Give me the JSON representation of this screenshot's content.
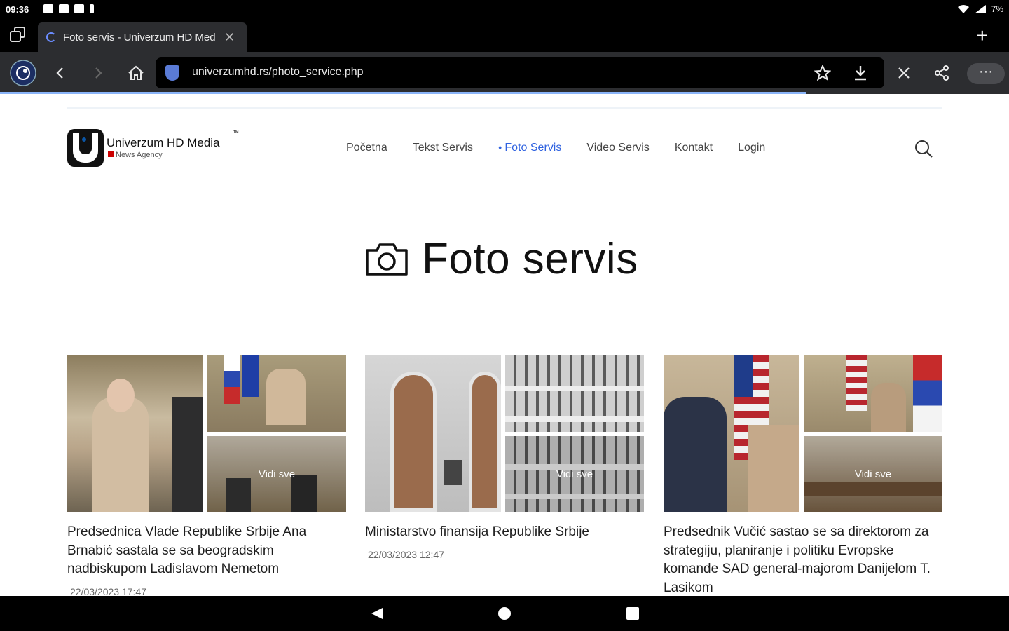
{
  "status_bar": {
    "time": "09:36",
    "battery": "7%"
  },
  "browser": {
    "tab_title": "Foto servis - Univerzum HD Med",
    "url": "univerzumhd.rs/photo_service.php"
  },
  "site": {
    "logo_name": "Univerzum HD Media",
    "logo_tagline": "News Agency",
    "logo_tm": "™",
    "nav": [
      "Početna",
      "Tekst Servis",
      "Foto Servis",
      "Video Servis",
      "Kontakt",
      "Login"
    ],
    "active_nav": "Foto Servis"
  },
  "page": {
    "heading": "Foto servis",
    "vidi_sve": "Vidi sve",
    "cards": [
      {
        "title": "Predsednica Vlade Republike Srbije Ana Brnabić sastala se sa beogradskim nadbiskupom Ladislavom Nemetom",
        "date": "22/03/2023 17:47"
      },
      {
        "title": "Ministarstvo finansija Republike Srbije",
        "date": "22/03/2023 12:47"
      },
      {
        "title": "Predsednik Vučić sastao se sa direktorom za strategiju, planiranje i politiku Evropske komande SAD general-majorom Danijelom T. Lasikom",
        "date": ""
      }
    ]
  },
  "colors": {
    "accent": "#2f62e0",
    "toolbar": "#2c2d30",
    "progress": "#8ab4f8"
  }
}
